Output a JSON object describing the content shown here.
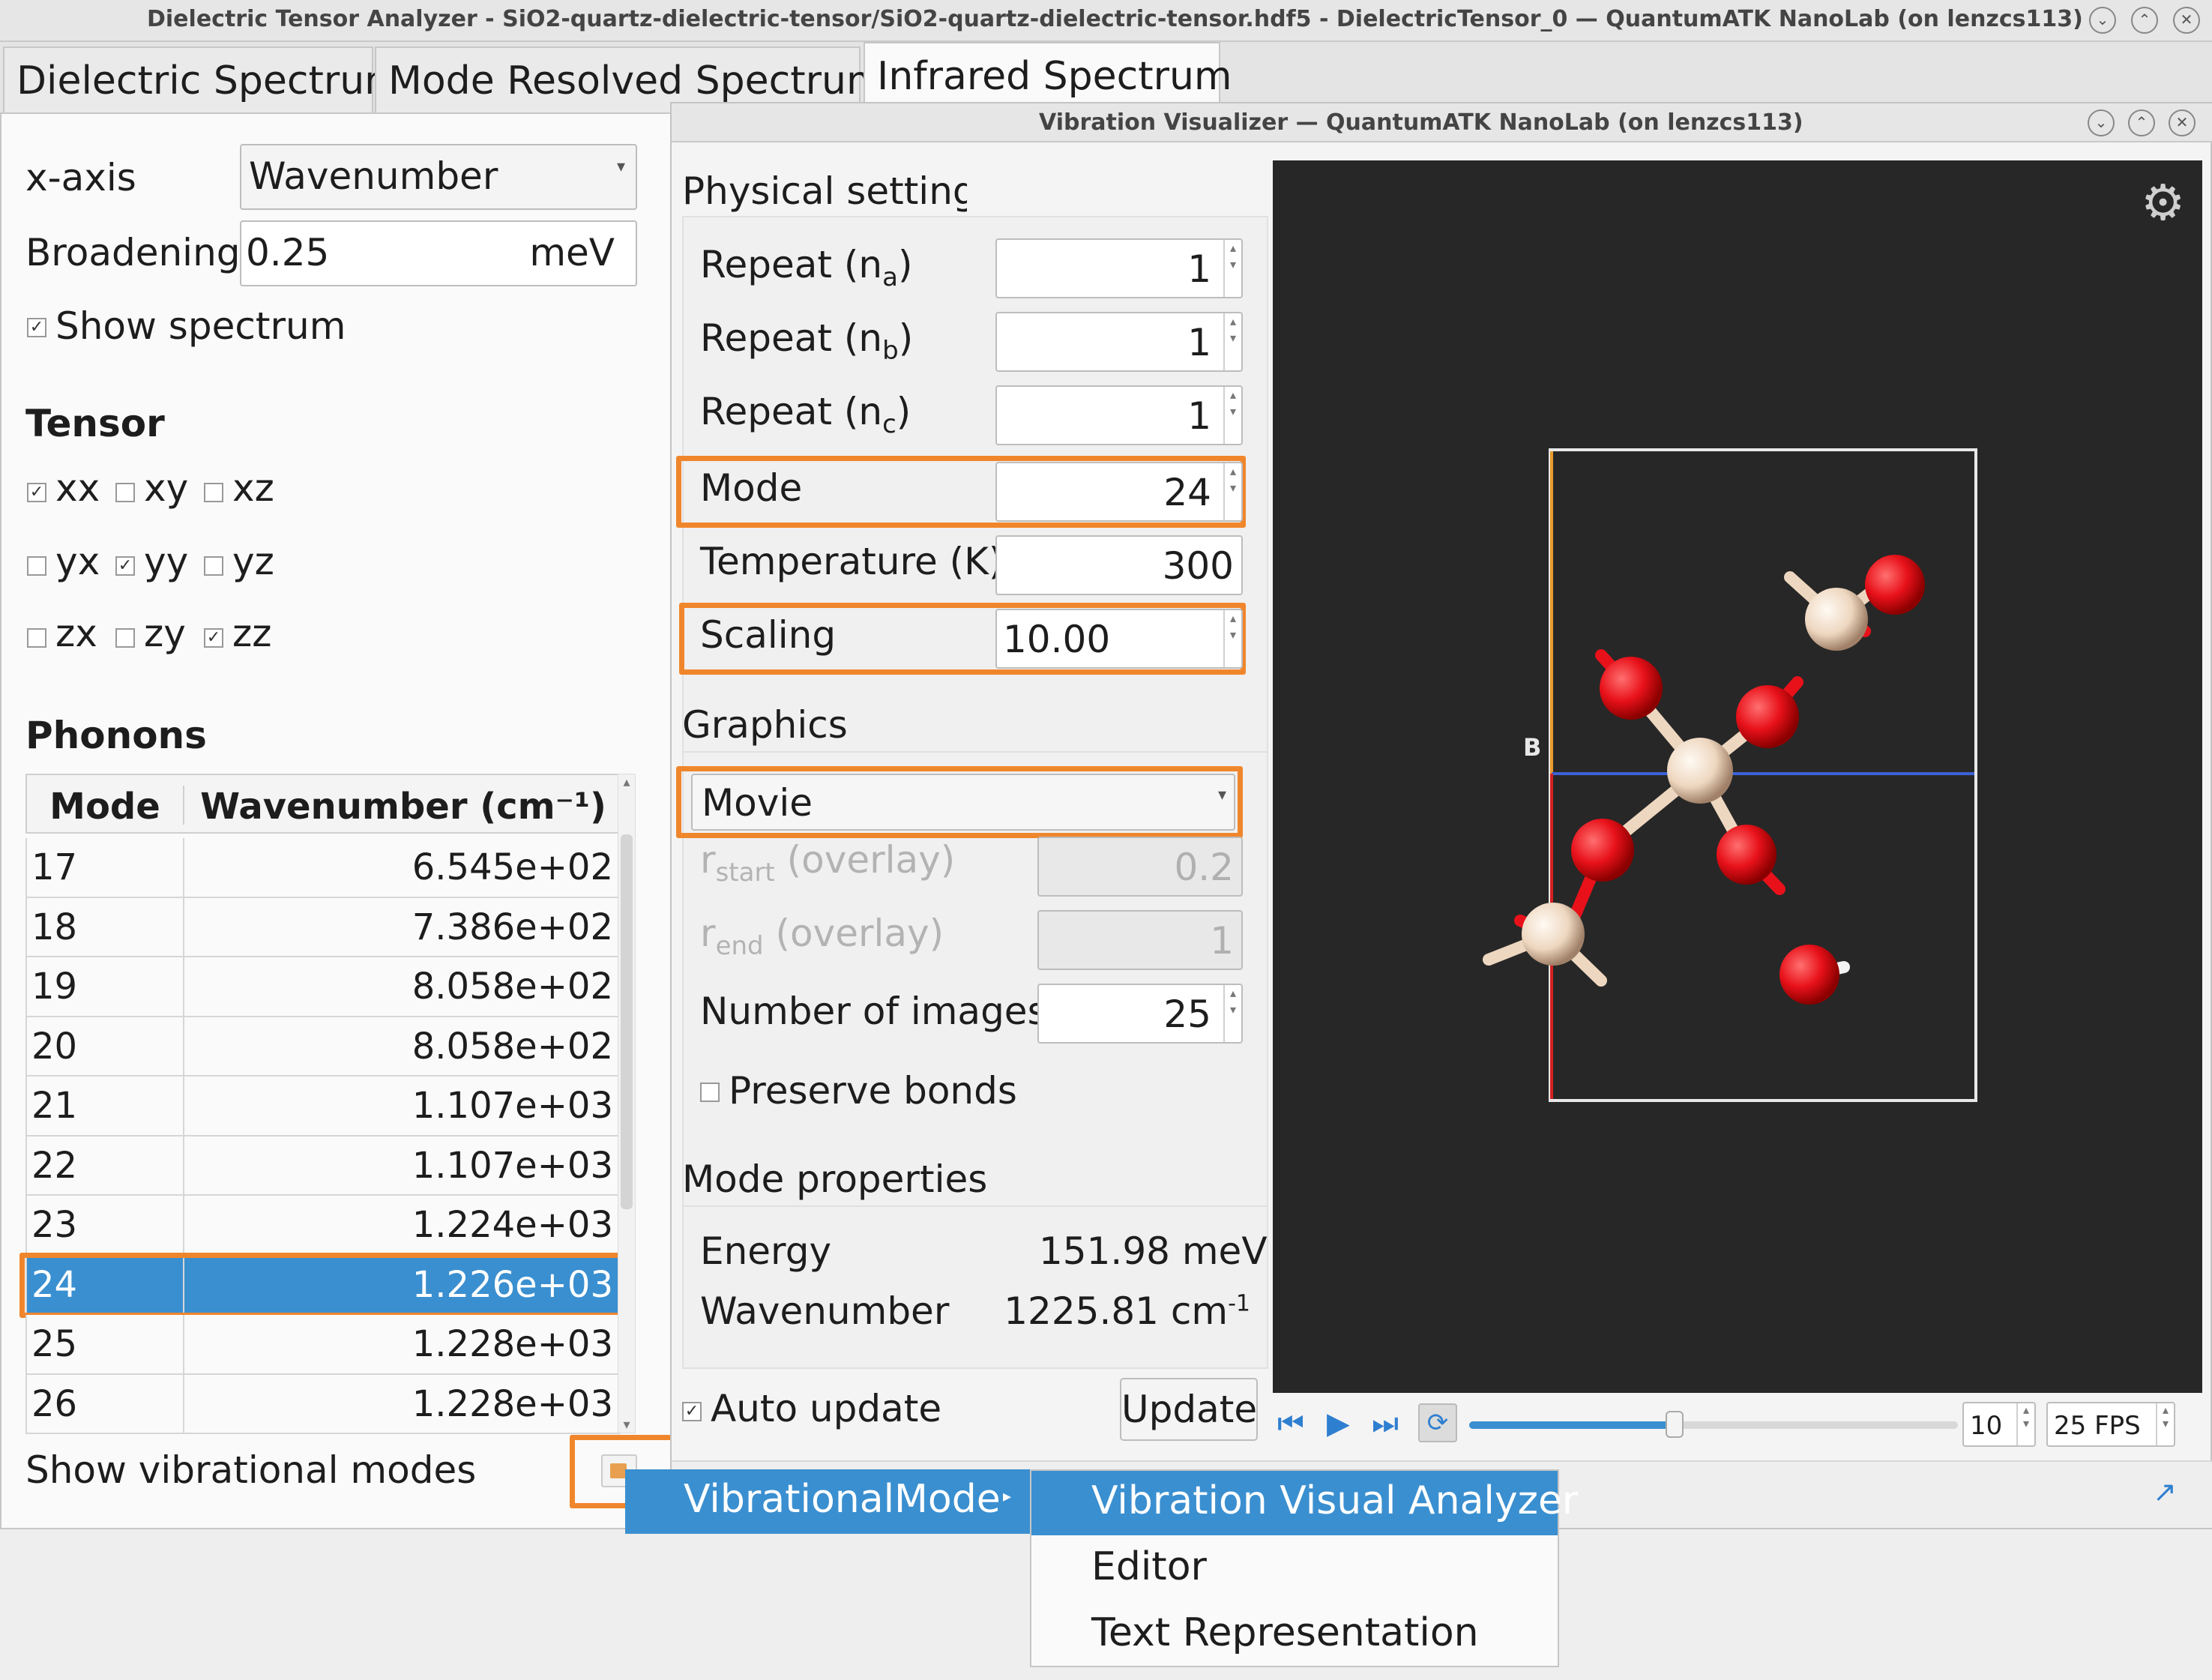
{
  "main_window": {
    "title": "Dielectric Tensor Analyzer - SiO2-quartz-dielectric-tensor/SiO2-quartz-dielectric-tensor.hdf5 - DielectricTensor_0 — QuantumATK NanoLab (on lenzcs113)",
    "tabs": [
      "Dielectric Spectrum",
      "Mode Resolved Spectrum",
      "Infrared Spectrum"
    ],
    "active_tab": "Infrared Spectrum"
  },
  "left_panel": {
    "xaxis_label": "x-axis",
    "xaxis_value": "Wavenumber",
    "broadening_label": "Broadening",
    "broadening_value": "0.25",
    "broadening_unit": "meV",
    "show_spectrum_label": "Show spectrum",
    "show_spectrum_checked": true,
    "tensor_title": "Tensor",
    "tensor": [
      {
        "label": "xx",
        "checked": true
      },
      {
        "label": "xy",
        "checked": false
      },
      {
        "label": "xz",
        "checked": false
      },
      {
        "label": "yx",
        "checked": false
      },
      {
        "label": "yy",
        "checked": true
      },
      {
        "label": "yz",
        "checked": false
      },
      {
        "label": "zx",
        "checked": false
      },
      {
        "label": "zy",
        "checked": false
      },
      {
        "label": "zz",
        "checked": true
      }
    ],
    "phonons_title": "Phonons",
    "table_headers": [
      "Mode",
      "Wavenumber (cm⁻¹)"
    ],
    "rows": [
      [
        "17",
        "6.545e+02"
      ],
      [
        "18",
        "7.386e+02"
      ],
      [
        "19",
        "8.058e+02"
      ],
      [
        "20",
        "8.058e+02"
      ],
      [
        "21",
        "1.107e+03"
      ],
      [
        "22",
        "1.107e+03"
      ],
      [
        "23",
        "1.224e+03"
      ],
      [
        "24",
        "1.226e+03"
      ],
      [
        "25",
        "1.228e+03"
      ],
      [
        "26",
        "1.228e+03"
      ]
    ],
    "selected_mode": "24",
    "show_vibrational_modes": "Show vibrational modes"
  },
  "visualizer": {
    "title": "Vibration Visualizer — QuantumATK NanoLab (on lenzcs113)",
    "physical_settings_title": "Physical settings",
    "repeat_a": {
      "label_main": "Repeat (n",
      "label_sub": "a",
      "label_end": ")",
      "value": "1"
    },
    "repeat_b": {
      "label_main": "Repeat (n",
      "label_sub": "b",
      "label_end": ")",
      "value": "1"
    },
    "repeat_c": {
      "label_main": "Repeat (n",
      "label_sub": "c",
      "label_end": ")",
      "value": "1"
    },
    "mode": {
      "label": "Mode",
      "value": "24"
    },
    "temperature": {
      "label": "Temperature (K)",
      "value": "300"
    },
    "scaling": {
      "label": "Scaling",
      "value": "10.00"
    },
    "graphics_title": "Graphics",
    "graphics_mode": "Movie",
    "r_start": {
      "label_main": "r",
      "label_sub": "start",
      "label_end": " (overlay)",
      "value": "0.2"
    },
    "r_end": {
      "label_main": "r",
      "label_sub": "end",
      "label_end": " (overlay)",
      "value": "1"
    },
    "number_of_images": {
      "label": "Number of images",
      "value": "25"
    },
    "preserve_bonds": {
      "label": "Preserve bonds",
      "checked": false
    },
    "mode_properties_title": "Mode properties",
    "energy": {
      "label": "Energy",
      "value": "151.98 meV"
    },
    "wavenumber": {
      "label": "Wavenumber",
      "value": "1225.81 cm",
      "sup": "-1"
    },
    "auto_update": {
      "label": "Auto update",
      "checked": true
    },
    "update_button": "Update",
    "axis_label_b": "B",
    "frame_value": "10",
    "fps_value": "25 FPS",
    "playback_fraction": 0.42
  },
  "context_menu": {
    "root": "VibrationalMode",
    "items": [
      "Vibration Visual Analyzer",
      "Editor",
      "Text Representation"
    ]
  },
  "colors": {
    "highlight": "#f0862c",
    "selection": "#3a8fd0",
    "oxygen": "#e8111a",
    "silicon": "#f1dcc6"
  }
}
